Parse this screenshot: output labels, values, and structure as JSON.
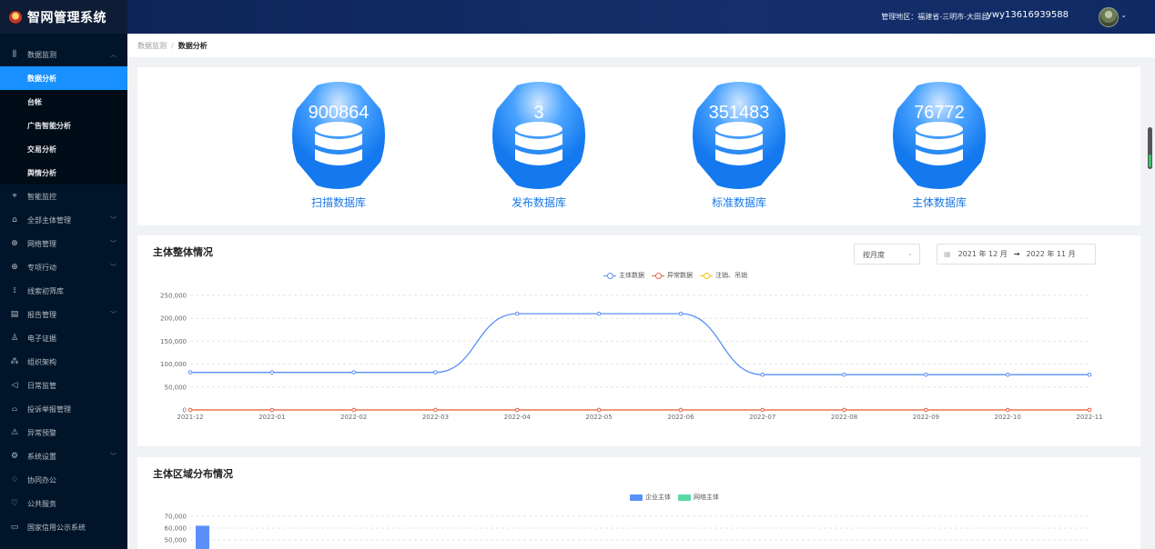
{
  "app": {
    "title": "智网管理系统"
  },
  "sidebar": {
    "items": [
      {
        "label": "数据监测",
        "icon": "bar-chart-icon",
        "glyph": "⫼",
        "expandable": true,
        "expanded": true
      },
      {
        "label": "智能监控",
        "icon": "monitor-icon",
        "glyph": "⌖",
        "expandable": false
      },
      {
        "label": "全部主体管理",
        "icon": "building-icon",
        "glyph": "⌂",
        "expandable": true
      },
      {
        "label": "网络管理",
        "icon": "globe-icon",
        "glyph": "⊕",
        "expandable": true
      },
      {
        "label": "专项行动",
        "icon": "globe-icon",
        "glyph": "⊕",
        "expandable": true
      },
      {
        "label": "线索初筛库",
        "icon": "filter-icon",
        "glyph": "⟟",
        "expandable": false
      },
      {
        "label": "报告管理",
        "icon": "report-icon",
        "glyph": "▤",
        "expandable": true
      },
      {
        "label": "电子证据",
        "icon": "evidence-icon",
        "glyph": "♙",
        "expandable": false
      },
      {
        "label": "组织架构",
        "icon": "org-icon",
        "glyph": "⁂",
        "expandable": false
      },
      {
        "label": "日常监管",
        "icon": "send-icon",
        "glyph": "◁",
        "expandable": false
      },
      {
        "label": "投诉举报管理",
        "icon": "complaint-icon",
        "glyph": "⌓",
        "expandable": false
      },
      {
        "label": "异常预警",
        "icon": "warning-icon",
        "glyph": "⚠",
        "expandable": false
      },
      {
        "label": "系统设置",
        "icon": "gear-icon",
        "glyph": "⚙",
        "expandable": true
      },
      {
        "label": "协同办公",
        "icon": "bell-icon",
        "glyph": "♢",
        "expandable": false
      },
      {
        "label": "公共服务",
        "icon": "heart-icon",
        "glyph": "♡",
        "expandable": false
      },
      {
        "label": "国家信用公示系统",
        "icon": "window-icon",
        "glyph": "▭",
        "expandable": false
      }
    ],
    "subitems": [
      {
        "label": "数据分析",
        "active": true
      },
      {
        "label": "台帐",
        "active": false
      },
      {
        "label": "广告智能分析",
        "active": false
      },
      {
        "label": "交易分析",
        "active": false
      },
      {
        "label": "舆情分析",
        "active": false
      }
    ]
  },
  "header": {
    "region": "管理地区：福建省-三明市-大田县",
    "user": "ywy13616939588"
  },
  "breadcrumb": {
    "parent": "数据监测",
    "separator": "/",
    "current": "数据分析"
  },
  "databases": [
    {
      "value": "900864",
      "label": "扫描数据库"
    },
    {
      "value": "3",
      "label": "发布数据库"
    },
    {
      "value": "351483",
      "label": "标准数据库"
    },
    {
      "value": "76772",
      "label": "主体数据库"
    }
  ],
  "overview": {
    "title": "主体整体情况",
    "granularity": "按月度",
    "range_start": "2021 年 12 月",
    "range_end": "2022 年 11 月"
  },
  "distribution": {
    "title": "主体区域分布情况"
  },
  "colors": {
    "accent": "#1890ff",
    "sidebar_bg": "#001529",
    "line_main": "#5b8ff9",
    "line_abnormal": "#e86452",
    "line_cancel": "#f6bd16",
    "bar_enterprise": "#5b8ff9",
    "bar_online": "#5ad8a6"
  },
  "chart_data": [
    {
      "type": "line",
      "title": "主体整体情况",
      "categories": [
        "2021-12",
        "2022-01",
        "2022-02",
        "2022-03",
        "2022-04",
        "2022-05",
        "2022-06",
        "2022-07",
        "2022-08",
        "2022-09",
        "2022-10",
        "2022-11"
      ],
      "series": [
        {
          "name": "主体数据",
          "color": "#5b8ff9",
          "values": [
            82000,
            82000,
            82000,
            82000,
            210000,
            210000,
            210000,
            77000,
            77000,
            77000,
            77000,
            77000
          ]
        },
        {
          "name": "异常数据",
          "color": "#e86452",
          "values": [
            0,
            0,
            0,
            0,
            0,
            0,
            0,
            0,
            0,
            0,
            0,
            0
          ]
        },
        {
          "name": "注销、吊销",
          "color": "#f6bd16",
          "values": [
            0,
            0,
            0,
            0,
            0,
            0,
            0,
            0,
            0,
            0,
            0,
            0
          ]
        }
      ],
      "y_ticks": [
        "250,000",
        "200,000",
        "150,000",
        "100,000",
        "50,000",
        "0"
      ],
      "ylim": [
        0,
        250000
      ],
      "smooth": true,
      "grid": true,
      "legend_position": "top-center"
    },
    {
      "type": "bar",
      "title": "主体区域分布情况",
      "series": [
        {
          "name": "企业主体",
          "color": "#5b8ff9",
          "values": [
            62000
          ]
        },
        {
          "name": "网络主体",
          "color": "#5ad8a6",
          "values": []
        }
      ],
      "y_ticks": [
        "70,000",
        "60,000",
        "50,000"
      ],
      "ylim": [
        0,
        70000
      ],
      "grid": true,
      "legend_position": "top-center"
    }
  ]
}
